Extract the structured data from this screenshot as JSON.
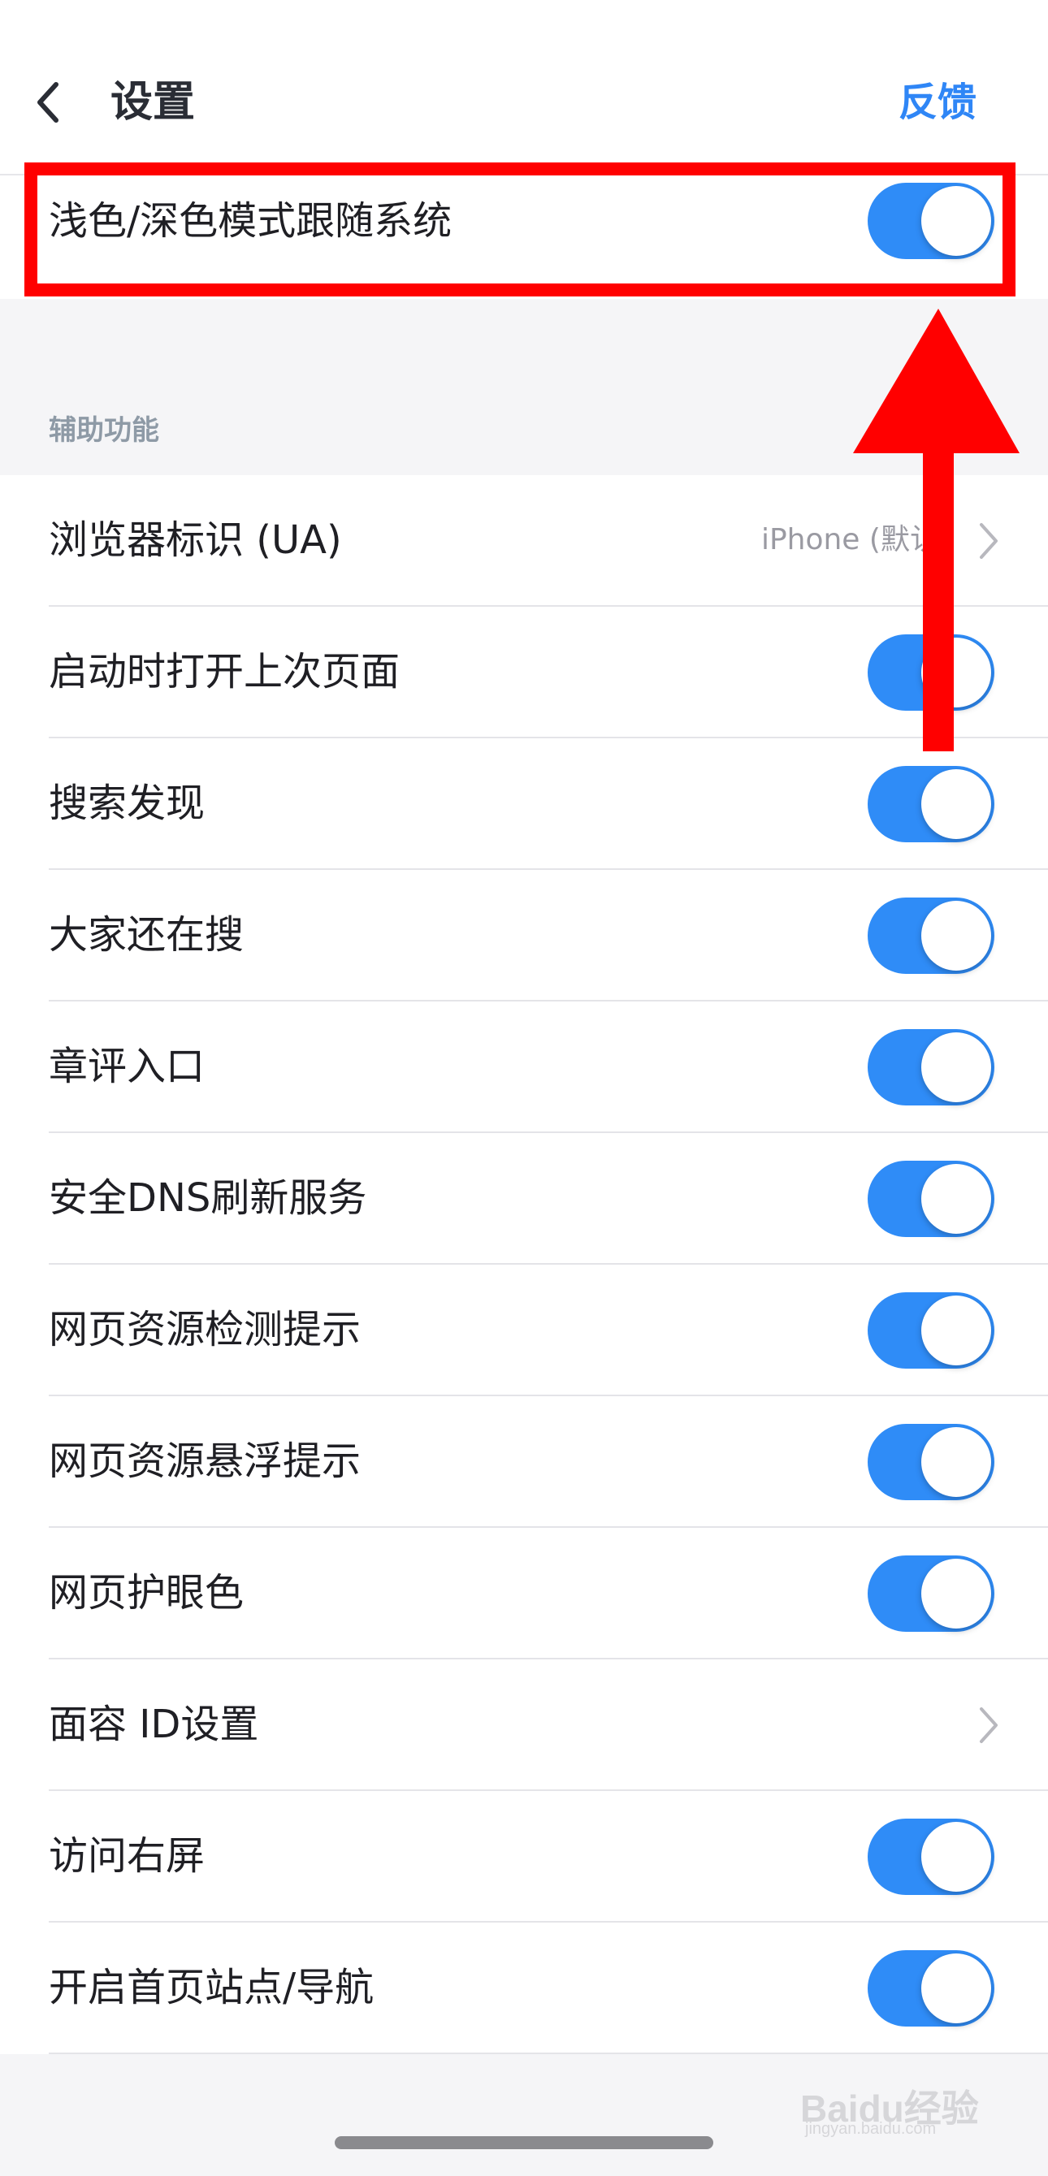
{
  "header": {
    "title": "设置",
    "feedback_label": "反馈"
  },
  "top_setting": {
    "label": "浅色/深色模式跟随系统",
    "enabled": true
  },
  "section": {
    "title": "辅助功能"
  },
  "items": [
    {
      "label": "浏览器标识 (UA)",
      "type": "link",
      "value": "iPhone (默认)"
    },
    {
      "label": "启动时打开上次页面",
      "type": "toggle",
      "enabled": true
    },
    {
      "label": "搜索发现",
      "type": "toggle",
      "enabled": true
    },
    {
      "label": "大家还在搜",
      "type": "toggle",
      "enabled": true
    },
    {
      "label": "章评入口",
      "type": "toggle",
      "enabled": true
    },
    {
      "label": "安全DNS刷新服务",
      "type": "toggle",
      "enabled": true
    },
    {
      "label": "网页资源检测提示",
      "type": "toggle",
      "enabled": true
    },
    {
      "label": "网页资源悬浮提示",
      "type": "toggle",
      "enabled": true
    },
    {
      "label": "网页护眼色",
      "type": "toggle",
      "enabled": true
    },
    {
      "label": "面容 ID设置",
      "type": "link",
      "value": ""
    },
    {
      "label": "访问右屏",
      "type": "toggle",
      "enabled": true
    },
    {
      "label": "开启首页站点/导航",
      "type": "toggle",
      "enabled": true
    }
  ],
  "watermark": {
    "text": "Baidu经验",
    "sub": "jingyan.baidu.com"
  },
  "colors": {
    "accent": "#2f8cf7",
    "link": "#2f86f6",
    "annotation": "#ff0000"
  }
}
